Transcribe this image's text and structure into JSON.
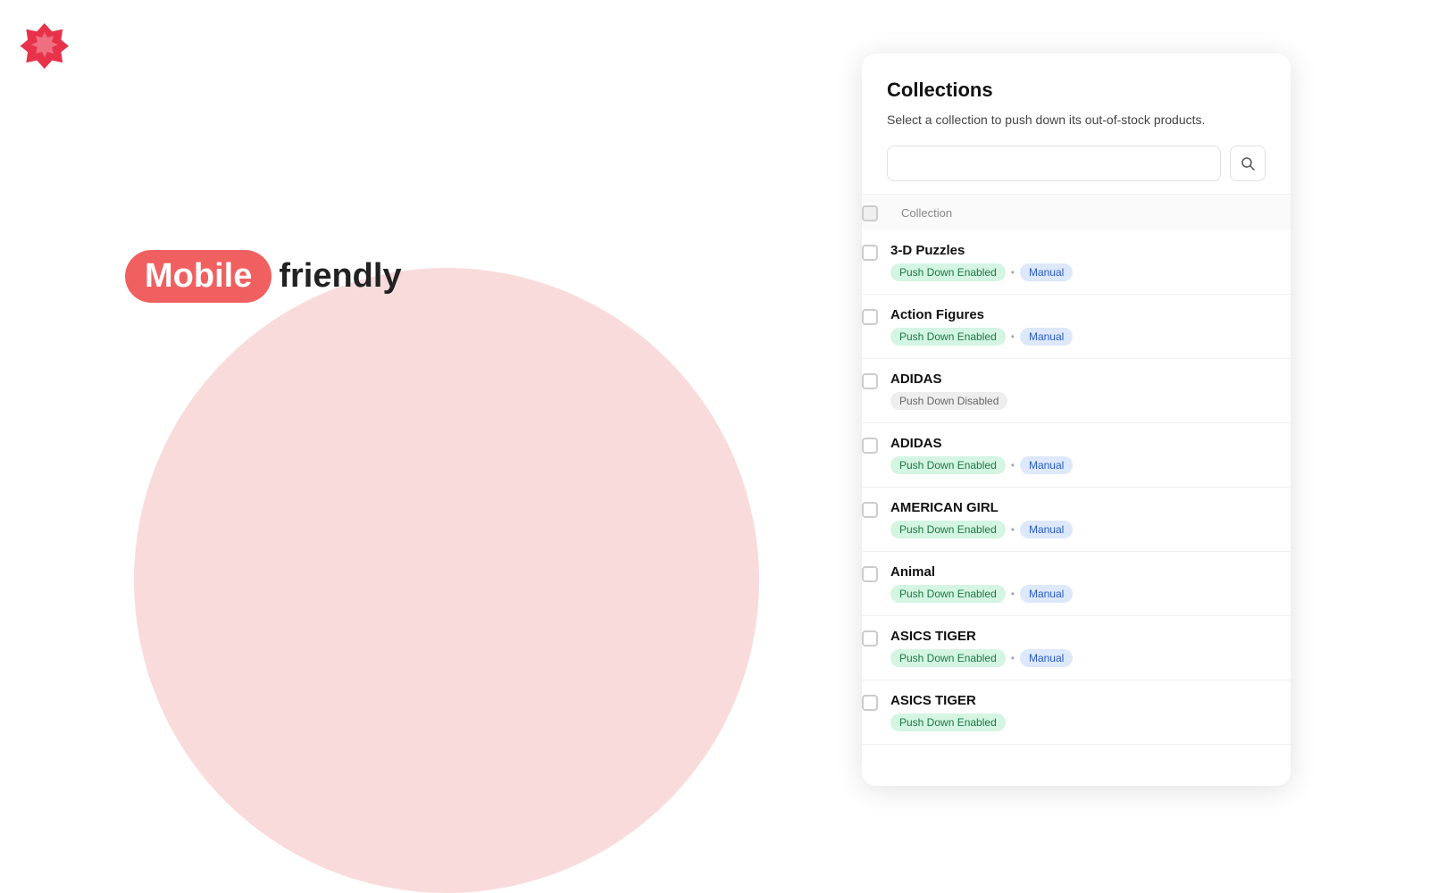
{
  "logo": {
    "alt": "App Logo"
  },
  "hero": {
    "mobile_label": "Mobile",
    "friendly_label": "friendly"
  },
  "panel": {
    "title": "Collections",
    "description": "Select a collection to push down its out-of-stock products.",
    "search_placeholder": "",
    "search_btn_label": "Search",
    "table_header_label": "Collection",
    "items": [
      {
        "name": "3-D Puzzles",
        "status": "Push Down Enabled",
        "status_type": "green",
        "mode": "Manual",
        "mode_type": "blue"
      },
      {
        "name": "Action Figures",
        "status": "Push Down Enabled",
        "status_type": "green",
        "mode": "Manual",
        "mode_type": "blue"
      },
      {
        "name": "ADIDAS",
        "status": "Push Down Disabled",
        "status_type": "gray",
        "mode": null,
        "mode_type": null
      },
      {
        "name": "ADIDAS",
        "status": "Push Down Enabled",
        "status_type": "green",
        "mode": "Manual",
        "mode_type": "blue"
      },
      {
        "name": "AMERICAN GIRL",
        "status": "Push Down Enabled",
        "status_type": "green",
        "mode": "Manual",
        "mode_type": "blue"
      },
      {
        "name": "Animal",
        "status": "Push Down Enabled",
        "status_type": "green",
        "mode": "Manual",
        "mode_type": "blue"
      },
      {
        "name": "ASICS TIGER",
        "status": "Push Down Enabled",
        "status_type": "green",
        "mode": "Manual",
        "mode_type": "blue"
      },
      {
        "name": "ASICS TIGER",
        "status": "Push Down Enabled",
        "status_type": "green",
        "mode": null,
        "mode_type": null
      }
    ]
  }
}
